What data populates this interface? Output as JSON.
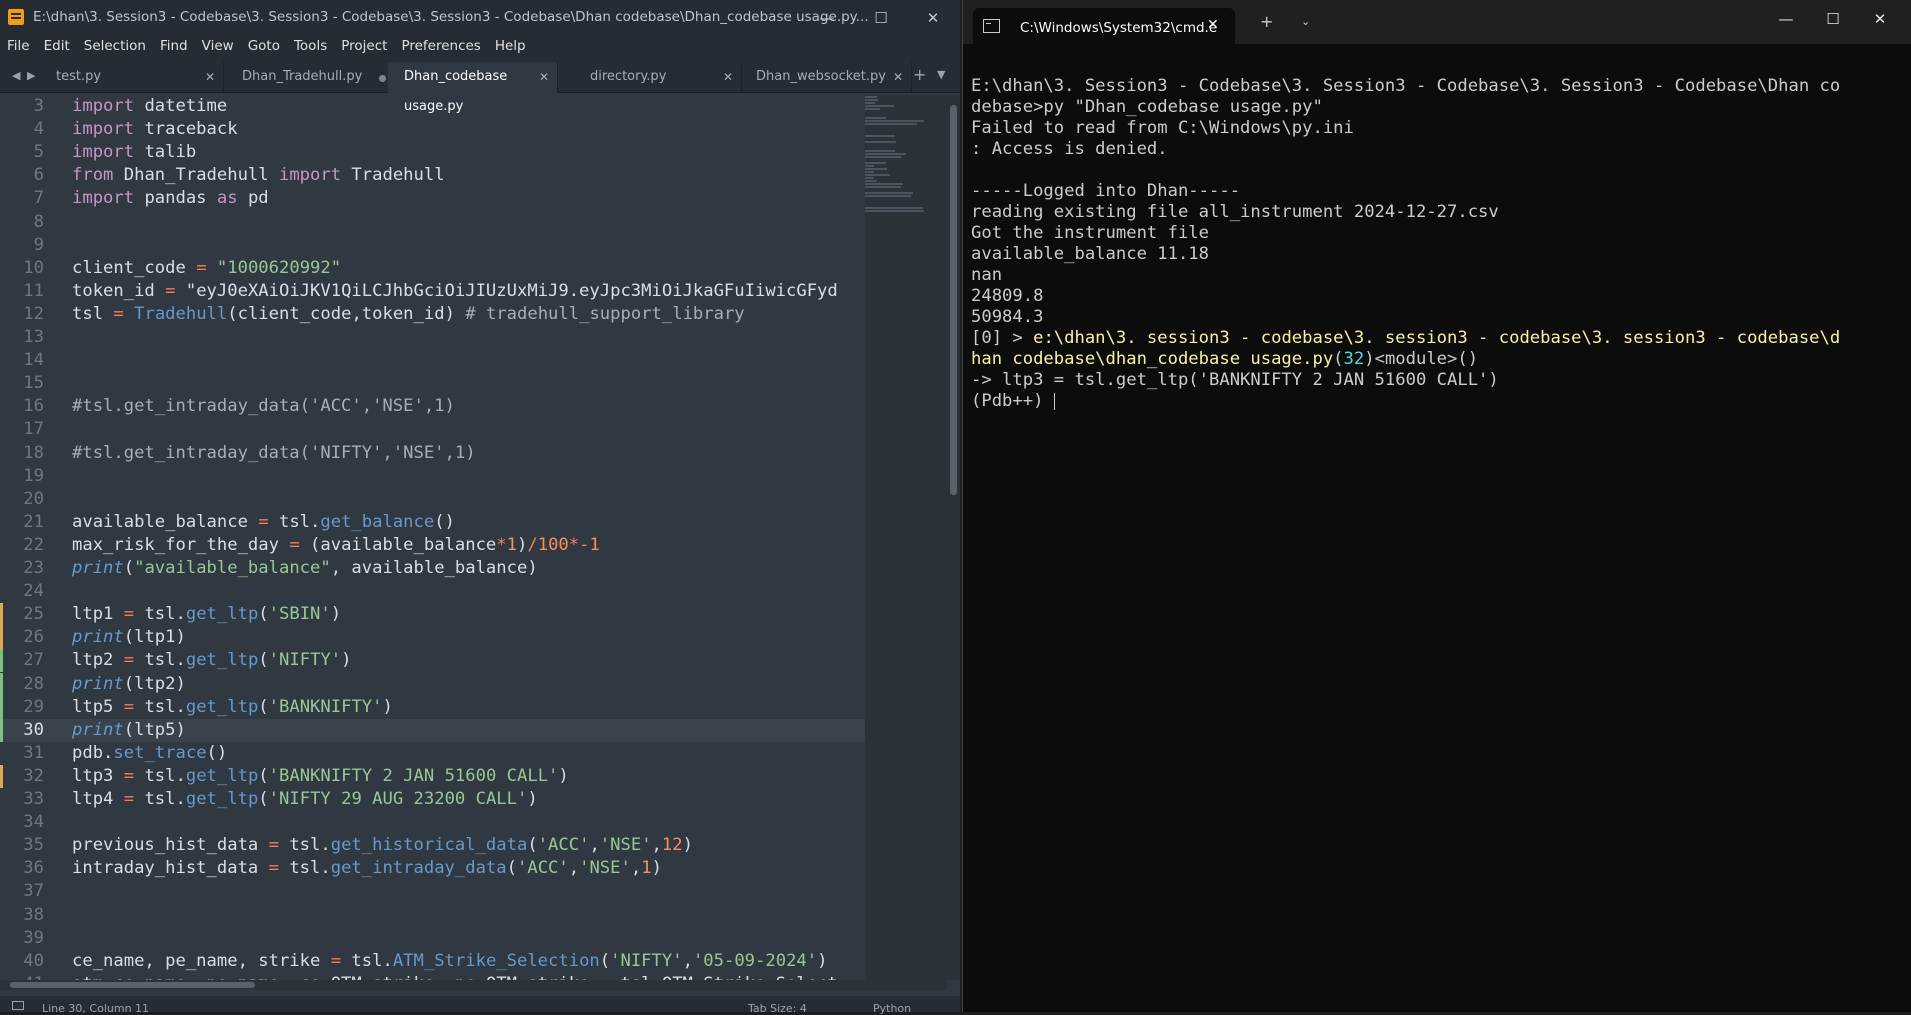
{
  "sublime": {
    "title": "E:\\dhan\\3. Session3 - Codebase\\3. Session3 - Codebase\\3. Session3 - Codebase\\Dhan codebase\\Dhan_codebase usage.py...",
    "menu": [
      "File",
      "Edit",
      "Selection",
      "Find",
      "View",
      "Goto",
      "Tools",
      "Project",
      "Preferences",
      "Help"
    ],
    "tabs": [
      {
        "label": "test.py",
        "state": "clean"
      },
      {
        "label": "Dhan_Tradehull.py",
        "state": "modified"
      },
      {
        "label": "Dhan_codebase usage.py",
        "state": "active"
      },
      {
        "label": "directory.py",
        "state": "clean"
      },
      {
        "label": "Dhan_websocket.py",
        "state": "clean"
      }
    ],
    "current_line": 30,
    "code": [
      {
        "n": 3,
        "t": "import datetime"
      },
      {
        "n": 4,
        "t": "import traceback"
      },
      {
        "n": 5,
        "t": "import talib"
      },
      {
        "n": 6,
        "t": "from Dhan_Tradehull import Tradehull"
      },
      {
        "n": 7,
        "t": "import pandas as pd"
      },
      {
        "n": 8,
        "t": ""
      },
      {
        "n": 9,
        "t": ""
      },
      {
        "n": 10,
        "t": "client_code = \"1000620992\""
      },
      {
        "n": 11,
        "t": "token_id = \"eyJ0eXAiOiJKV1QiLCJhbGciOiJIUzUxMiJ9.eyJpc3MiOiJkaGFuIiwicGFyd"
      },
      {
        "n": 12,
        "t": "tsl = Tradehull(client_code,token_id) # tradehull_support_library"
      },
      {
        "n": 13,
        "t": ""
      },
      {
        "n": 14,
        "t": ""
      },
      {
        "n": 15,
        "t": ""
      },
      {
        "n": 16,
        "t": "#tsl.get_intraday_data('ACC','NSE',1)"
      },
      {
        "n": 17,
        "t": ""
      },
      {
        "n": 18,
        "t": "#tsl.get_intraday_data('NIFTY','NSE',1)"
      },
      {
        "n": 19,
        "t": ""
      },
      {
        "n": 20,
        "t": ""
      },
      {
        "n": 21,
        "t": "available_balance = tsl.get_balance()"
      },
      {
        "n": 22,
        "t": "max_risk_for_the_day = (available_balance*1)/100*-1"
      },
      {
        "n": 23,
        "t": "print(\"available_balance\", available_balance)"
      },
      {
        "n": 24,
        "t": ""
      },
      {
        "n": 25,
        "t": "ltp1 = tsl.get_ltp('SBIN')"
      },
      {
        "n": 26,
        "t": "print(ltp1)"
      },
      {
        "n": 27,
        "t": "ltp2 = tsl.get_ltp('NIFTY')"
      },
      {
        "n": 28,
        "t": "print(ltp2)"
      },
      {
        "n": 29,
        "t": "ltp5 = tsl.get_ltp('BANKNIFTY')"
      },
      {
        "n": 30,
        "t": "print(ltp5)"
      },
      {
        "n": 31,
        "t": "pdb.set_trace()"
      },
      {
        "n": 32,
        "t": "ltp3 = tsl.get_ltp('BANKNIFTY 2 JAN 51600 CALL')"
      },
      {
        "n": 33,
        "t": "ltp4 = tsl.get_ltp('NIFTY 29 AUG 23200 CALL')"
      },
      {
        "n": 34,
        "t": ""
      },
      {
        "n": 35,
        "t": "previous_hist_data = tsl.get_historical_data('ACC','NSE',12)"
      },
      {
        "n": 36,
        "t": "intraday_hist_data = tsl.get_intraday_data('ACC','NSE',1)"
      },
      {
        "n": 37,
        "t": ""
      },
      {
        "n": 38,
        "t": ""
      },
      {
        "n": 39,
        "t": ""
      },
      {
        "n": 40,
        "t": "ce_name, pe_name, strike = tsl.ATM_Strike_Selection('NIFTY','05-09-2024')"
      },
      {
        "n": 41,
        "t": "otm_ce_name, pe_name, ce_OTM_strike, pe_OTM_strike = tsl.OTM_Strike_Select"
      }
    ],
    "status": {
      "position": "Line 30, Column 11",
      "tab_size": "Tab Size: 4",
      "syntax": "Python"
    }
  },
  "terminal": {
    "tab_title": "C:\\Windows\\System32\\cmd.e",
    "lines": [
      "E:\\dhan\\3. Session3 - Codebase\\3. Session3 - Codebase\\3. Session3 - Codebase\\Dhan co",
      "debase>py \"Dhan_codebase usage.py\"",
      "Failed to read from C:\\Windows\\py.ini",
      ": Access is denied.",
      "",
      "-----Logged into Dhan-----",
      "reading existing file all_instrument 2024-12-27.csv",
      "Got the instrument file",
      "available_balance 11.18",
      "nan",
      "24809.8",
      "50984.3"
    ],
    "trace_prefix": "[0] > ",
    "trace_path_1": "e:\\dhan\\3. session3 - codebase\\3. session3 - codebase\\3. session3 - codebase\\d",
    "trace_path_2": "han codebase\\dhan_codebase usage.py",
    "trace_lineno": "32",
    "trace_module": "<module>()",
    "current_stmt": "-> ltp3 = tsl.get_ltp('BANKNIFTY 2 JAN 51600 CALL')",
    "prompt": "(Pdb++) "
  }
}
